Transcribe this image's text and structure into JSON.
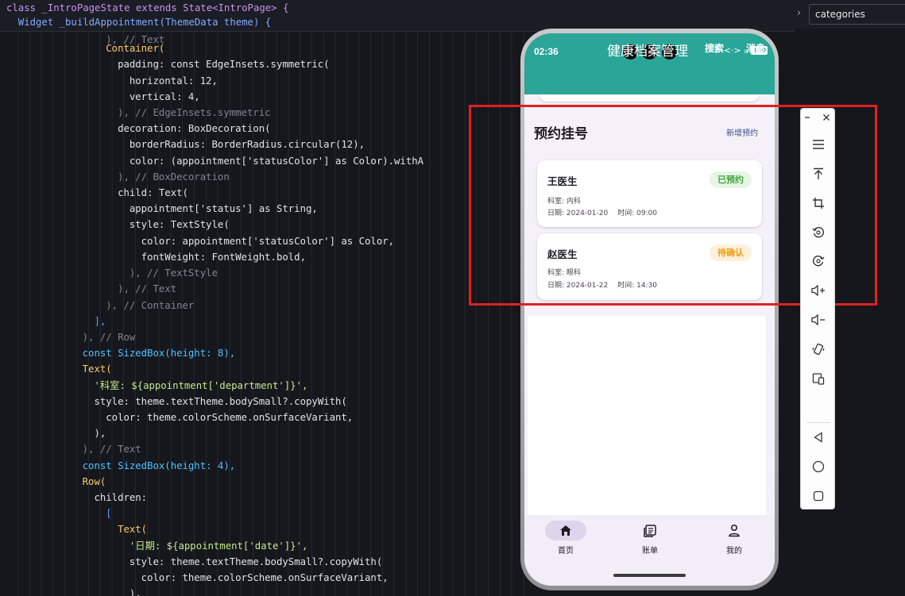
{
  "editor": {
    "sticky_header": [
      "class _IntroPageState extends State<IntroPage> {",
      "  Widget _buildAppointment(ThemeData theme) {"
    ],
    "code_lines": [
      "                  ), // Text",
      "                  Container(",
      "                    padding: const EdgeInsets.symmetric(",
      "                      horizontal: 12,",
      "                      vertical: 4,",
      "                    ), // EdgeInsets.symmetric",
      "                    decoration: BoxDecoration(",
      "                      borderRadius: BorderRadius.circular(12),",
      "                      color: (appointment['statusColor'] as Color).withA",
      "                    ), // BoxDecoration",
      "                    child: Text(",
      "                      appointment['status'] as String,",
      "                      style: TextStyle(",
      "                        color: appointment['statusColor'] as Color,",
      "                        fontWeight: FontWeight.bold,",
      "                      ), // TextStyle",
      "                    ), // Text",
      "                  ), // Container",
      "                ],",
      "              ), // Row",
      "              const SizedBox(height: 8),",
      "              Text(",
      "                '科室: ${appointment['department']}',",
      "                style: theme.textTheme.bodySmall?.copyWith(",
      "                  color: theme.colorScheme.onSurfaceVariant,",
      "                ),",
      "              ), // Text",
      "              const SizedBox(height: 4),",
      "              Row(",
      "                children:",
      "                  [",
      "                    Text(",
      "                      '日期: ${appointment['date']}',",
      "                      style: theme.textTheme.bodySmall?.copyWith(",
      "                        color: theme.colorScheme.onSurfaceVariant,",
      "                      ),"
    ]
  },
  "search_box": {
    "value": "categories"
  },
  "phone": {
    "status_time": "02:36",
    "status_icons": "☾ <·> ᵢₗₗ",
    "battery": "100",
    "app_title": "健康档案管理",
    "actions": {
      "search": "搜索",
      "messages": "消息"
    },
    "section_title": "预约挂号",
    "new_appointment": "新增预约",
    "appointments": [
      {
        "doctor": "王医生",
        "status": "已预约",
        "department": "科室: 内科",
        "date": "日期: 2024-01-20",
        "time": "时间: 09:00",
        "status_color": "#3fa43a"
      },
      {
        "doctor": "赵医生",
        "status": "待确认",
        "department": "科室: 眼科",
        "date": "日期: 2024-01-22",
        "time": "时间: 14:30",
        "status_color": "#ef9b12"
      }
    ],
    "nav": {
      "home": "首页",
      "bills": "账单",
      "mine": "我的"
    },
    "theme_color": "#2aa598"
  },
  "emulator_toolbar": {
    "icons": [
      "minimize-icon",
      "close-icon",
      "menu-icon",
      "pin-to-top-icon",
      "screenshot-crop-icon",
      "rotate-left-icon",
      "rotate-right-icon",
      "volume-up-icon",
      "volume-down-icon",
      "shake-icon",
      "multi-device-icon",
      "back-icon",
      "home-icon",
      "overview-icon"
    ]
  },
  "highlight_color": "#e02020"
}
